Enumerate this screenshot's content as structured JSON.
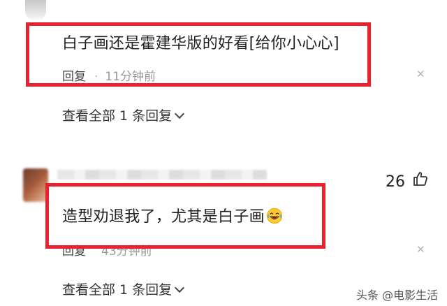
{
  "comment_1": {
    "text": "白子画还是霍建华版的好看[给你小心心]",
    "reply_label": "回复",
    "separator": "·",
    "time": "11分钟前",
    "close_glyph": "✕",
    "expand_label": "查看全部 1 条回复"
  },
  "comment_2": {
    "like_count": "26",
    "text": "造型劝退我了，尤其是白子画",
    "emoji": "laughing-with-tears-emoji",
    "reply_label": "回复",
    "time": "43分钟前",
    "close_glyph": "✕",
    "expand_label": "查看全部 1 条回复"
  },
  "watermark": "头条 @电影生活",
  "colors": {
    "highlight": "#e8232f",
    "text_primary": "#222222",
    "text_meta": "#9a9a9a"
  }
}
